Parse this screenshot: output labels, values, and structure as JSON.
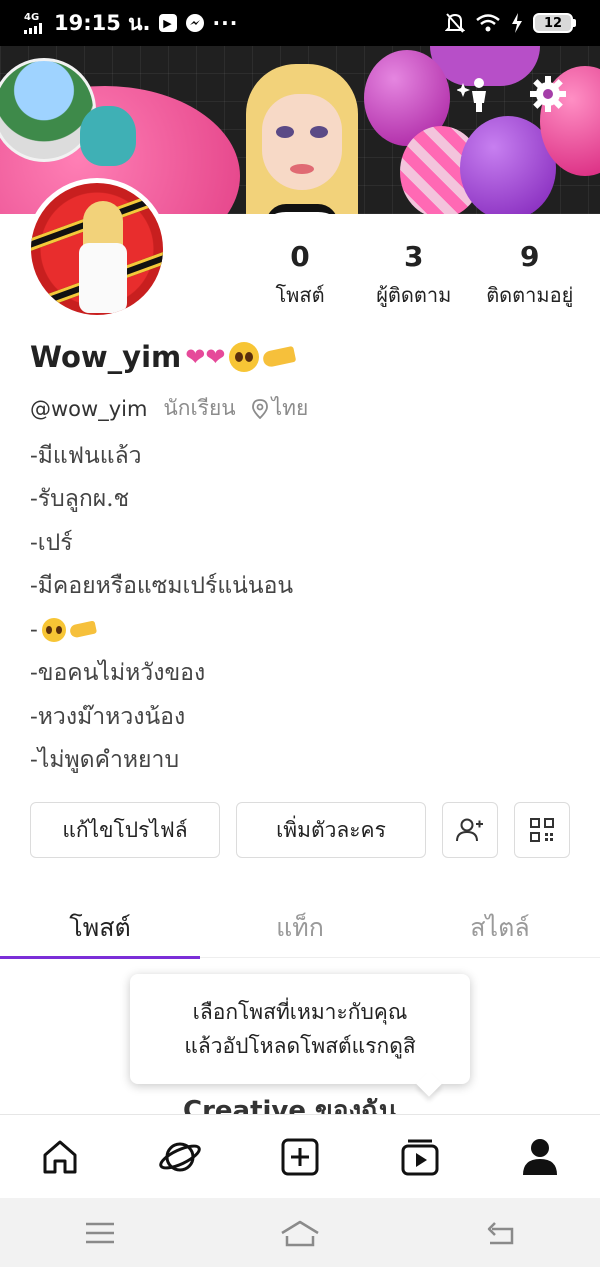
{
  "status_bar": {
    "network": "4G",
    "time": "19:15 น.",
    "more": "···",
    "battery": "12"
  },
  "profile": {
    "display_name": "Wow_yim",
    "handle": "@wow_yim",
    "role": "นักเรียน",
    "location": "ไทย",
    "stats": [
      {
        "value": "0",
        "label": "โพสต์"
      },
      {
        "value": "3",
        "label": "ผู้ติดตาม"
      },
      {
        "value": "9",
        "label": "ติดตามอยู่"
      }
    ],
    "bio": [
      "-มีแฟนแล้ว",
      "-รับลูกผ.ช",
      "-เปร์",
      "-มีคอยหรือแซมเปร์แน่นอน",
      "-",
      "-ขอคนไม่หวังของ",
      "-หวงม๊าหวงน้อง",
      "-ไม่พูดคำหยาบ"
    ]
  },
  "actions": {
    "edit_profile": "แก้ไขโปรไฟล์",
    "add_character": "เพิ่มตัวละคร"
  },
  "tabs": [
    "โพสต์",
    "แท็ก",
    "สไตล์"
  ],
  "active_tab": 0,
  "tooltip": {
    "line1": "เลือกโพสที่เหมาะกับคุณ",
    "line2": "แล้วอัปโหลดโพสต์แรกดูสิ"
  },
  "section_peek": "Creative ของฉัน",
  "colors": {
    "accent": "#7b2fd8",
    "status_bar": "#000000",
    "system_bar": "#f2f2f2"
  },
  "icons": {
    "cover": [
      "avatar-sparkle-icon",
      "settings-icon"
    ],
    "action_buttons": [
      "add-friend-icon",
      "qr-code-icon"
    ],
    "bottom_nav": [
      "home-icon",
      "planet-icon",
      "add-post-icon",
      "video-icon",
      "profile-icon"
    ],
    "system_nav": [
      "menu-icon",
      "home-outline-icon",
      "back-icon"
    ]
  }
}
